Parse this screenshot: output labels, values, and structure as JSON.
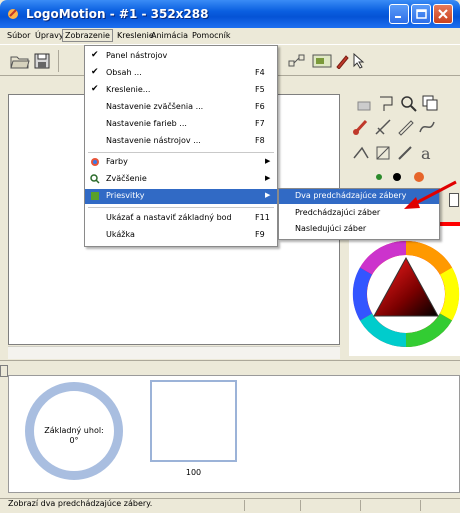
{
  "window": {
    "title": "LogoMotion - #1 - 352x288"
  },
  "menubar": {
    "items": [
      "Súbor",
      "Úpravy",
      "Zobrazenie",
      "Kreslenie",
      "Animácia",
      "Pomocník"
    ]
  },
  "view_menu": {
    "items": [
      {
        "label": "Panel nástrojov",
        "checked": true,
        "shortcut": ""
      },
      {
        "label": "Obsah ...",
        "checked": true,
        "shortcut": "F4"
      },
      {
        "label": "Kreslenie...",
        "checked": true,
        "shortcut": "F5"
      },
      {
        "label": "Nastavenie zväčšenia ...",
        "checked": false,
        "shortcut": "F6"
      },
      {
        "label": "Nastavenie farieb ...",
        "checked": false,
        "shortcut": "F7"
      },
      {
        "label": "Nastavenie nástrojov ...",
        "checked": false,
        "shortcut": "F8"
      },
      {
        "label": "Farby",
        "submenu": true
      },
      {
        "label": "Zväčšenie",
        "submenu": true
      },
      {
        "label": "Priesvitky",
        "submenu": true,
        "highlighted": true
      },
      {
        "label": "Ukázať a nastaviť základný bod",
        "shortcut": "F11"
      },
      {
        "label": "Ukážka",
        "shortcut": "F9"
      }
    ]
  },
  "priesvitky_submenu": {
    "items": [
      {
        "label": "Dva predchádzajúce zábery",
        "highlighted": true
      },
      {
        "label": "Predchádzajúci záber"
      },
      {
        "label": "Nasledujúci záber"
      }
    ]
  },
  "frames": {
    "base_label_line1": "Základný uhol:",
    "base_label_line2": "0°",
    "frame_number": "100"
  },
  "statusbar": {
    "text": "Zobrazí dva predchádzajúce zábery."
  },
  "colors": {
    "titlebar": "#0553d6",
    "highlight": "#316ac5",
    "annotation_arrow": "#e00000",
    "selected_color": "#ff0000"
  },
  "icons": [
    "app-icon",
    "minimize-icon",
    "maximize-icon",
    "close-icon",
    "open-icon",
    "save-icon",
    "checkmark-icon",
    "colors-icon",
    "zoom-icon",
    "transparency-icon",
    "pencil-icon",
    "color-wheel-icon"
  ]
}
